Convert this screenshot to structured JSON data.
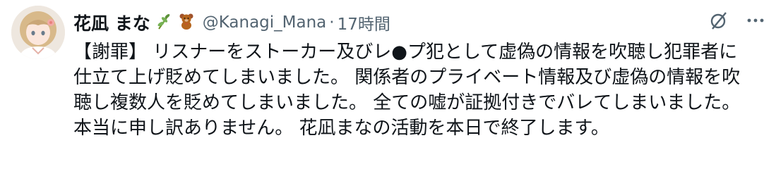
{
  "tweet": {
    "display_name": "花凪 まな",
    "name_emojis": [
      "seedling-emoji",
      "teddy-bear-emoji"
    ],
    "handle": "@Kanagi_Mana",
    "separator": "·",
    "time": "17時間",
    "text": "【謝罪】 リスナーをストーカー及びレ●プ犯として虚偽の情報を吹聴し犯罪者に仕立て上げ貶めてしまいました。 関係者のプライベート情報及び虚偽の情報を吹聴し複数人を貶めてしまいました。 全ての嘘が証拠付きでバレてしまいました。 本当に申し訳ありません。 花凪まなの活動を本日で終了します。"
  },
  "icons": {
    "grok": "grok-slash-icon",
    "more": "more-options-icon"
  },
  "colors": {
    "text_primary": "#0f1419",
    "text_secondary": "#536471",
    "background": "#ffffff"
  }
}
